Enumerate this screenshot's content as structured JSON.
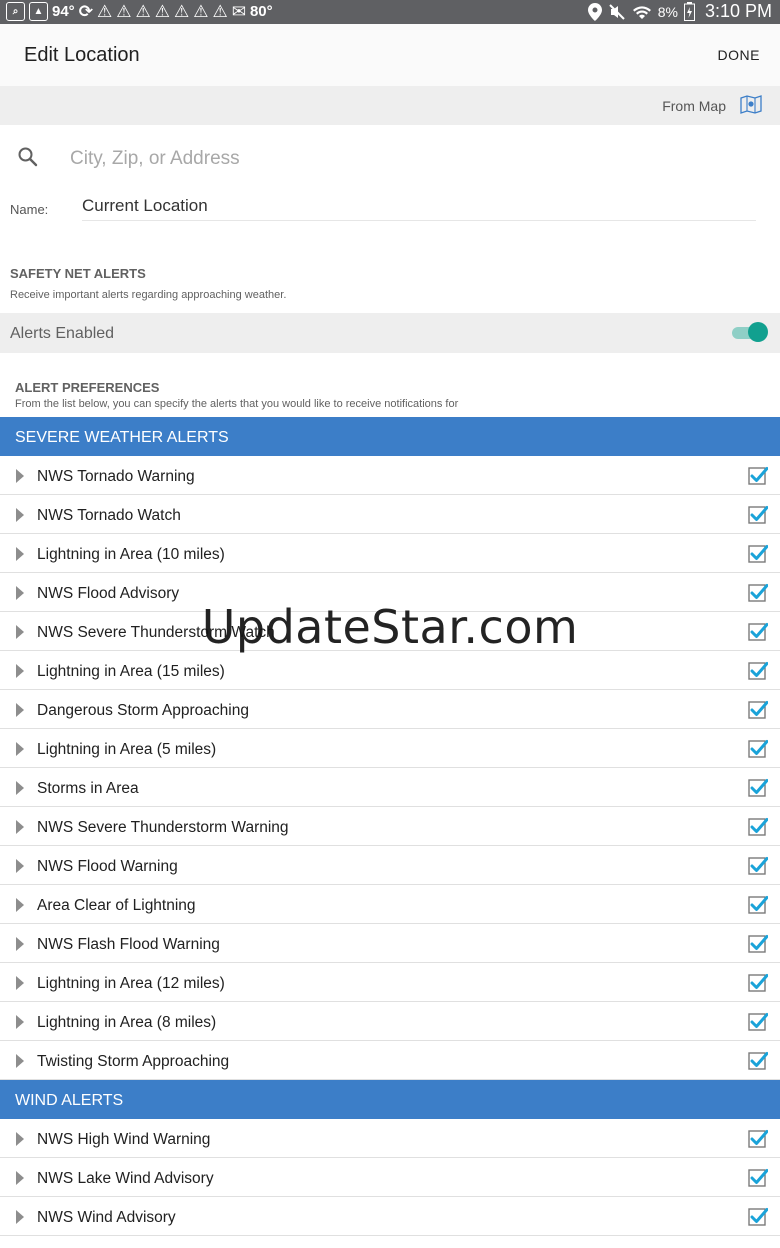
{
  "status_bar": {
    "battery_temp": "94°",
    "temp2": "80°",
    "battery_pct": "8%",
    "time": "3:10 PM"
  },
  "app_bar": {
    "title": "Edit Location",
    "done_label": "DONE"
  },
  "from_map": {
    "label": "From Map",
    "icon": "map-pin-icon"
  },
  "search": {
    "placeholder": "City, Zip, or Address",
    "icon": "search-icon"
  },
  "name_field": {
    "label": "Name:",
    "value": "Current Location"
  },
  "safety_net": {
    "title": "SAFETY NET ALERTS",
    "subtitle": "Receive important alerts regarding approaching weather.",
    "toggle_label": "Alerts Enabled",
    "toggle_on": true,
    "toggle_color": "#11a08f"
  },
  "preferences": {
    "title": "ALERT PREFERENCES",
    "subtitle": "From the list below, you can specify the alerts that you would like to receive notifications for"
  },
  "groups": [
    {
      "header": "SEVERE WEATHER ALERTS",
      "items": [
        {
          "label": "NWS Tornado Warning",
          "checked": true
        },
        {
          "label": "NWS Tornado Watch",
          "checked": true
        },
        {
          "label": "Lightning in Area (10 miles)",
          "checked": true
        },
        {
          "label": "NWS Flood Advisory",
          "checked": true
        },
        {
          "label": "NWS Severe Thunderstorm Watch",
          "checked": true
        },
        {
          "label": "Lightning in Area (15 miles)",
          "checked": true
        },
        {
          "label": "Dangerous Storm Approaching",
          "checked": true
        },
        {
          "label": "Lightning in Area (5 miles)",
          "checked": true
        },
        {
          "label": "Storms in Area",
          "checked": true
        },
        {
          "label": "NWS Severe Thunderstorm Warning",
          "checked": true
        },
        {
          "label": "NWS Flood Warning",
          "checked": true
        },
        {
          "label": "Area Clear of Lightning",
          "checked": true
        },
        {
          "label": "NWS Flash Flood Warning",
          "checked": true
        },
        {
          "label": "Lightning in Area (12 miles)",
          "checked": true
        },
        {
          "label": "Lightning in Area (8 miles)",
          "checked": true
        },
        {
          "label": "Twisting Storm Approaching",
          "checked": true
        }
      ]
    },
    {
      "header": "WIND ALERTS",
      "items": [
        {
          "label": "NWS High Wind Warning",
          "checked": true
        },
        {
          "label": "NWS Lake Wind Advisory",
          "checked": true
        },
        {
          "label": "NWS Wind Advisory",
          "checked": true
        }
      ]
    }
  ],
  "colors": {
    "group_header": "#3c7ec8",
    "checkbox": "#1aa3d9"
  },
  "watermark": "UpdateStar.com"
}
